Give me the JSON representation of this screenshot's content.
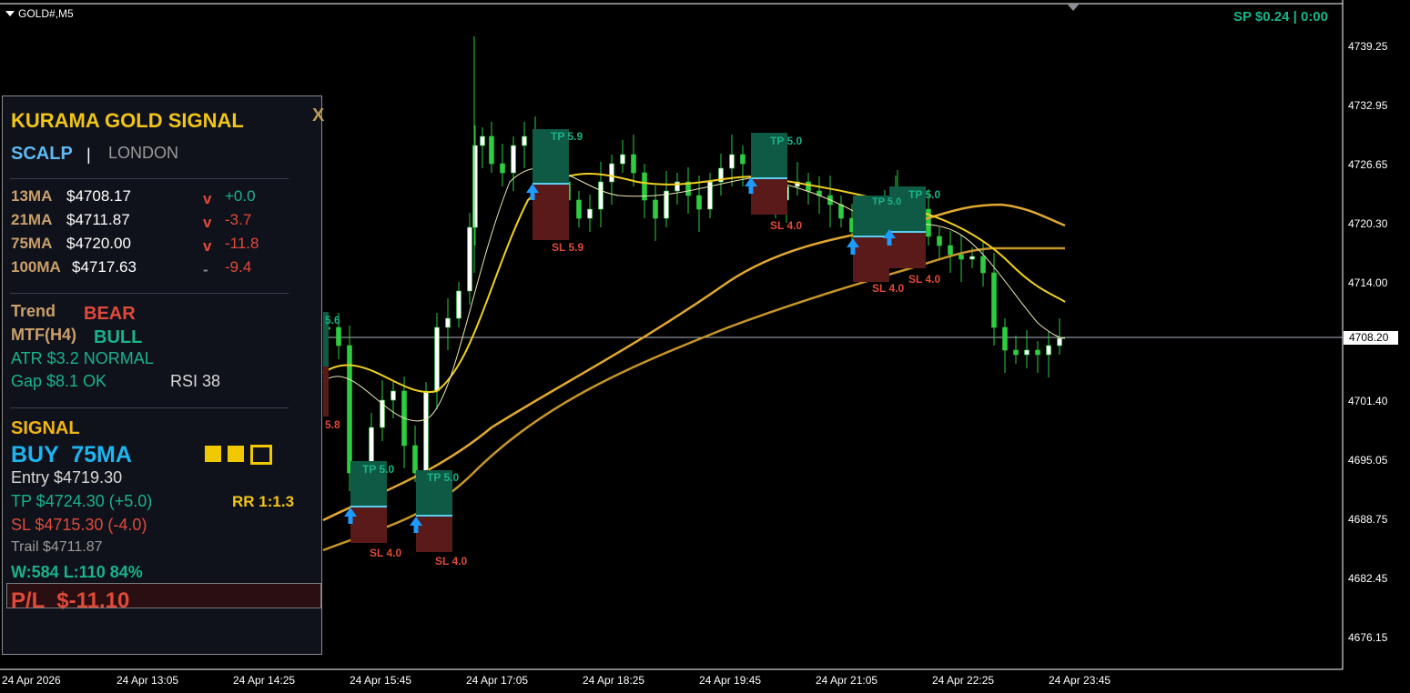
{
  "symbol": "GOLD#,M5",
  "spread_status": "SP $0.24  |  0:00",
  "current_price": "4708.20",
  "y_axis": [
    "4739.25",
    "4732.95",
    "4726.65",
    "4720.30",
    "4714.00",
    "4708.20",
    "4701.40",
    "4695.05",
    "4688.75",
    "4682.45",
    "4676.15"
  ],
  "x_axis": [
    "24 Apr 2026",
    "24 Apr 13:05",
    "24 Apr 14:25",
    "24 Apr 15:45",
    "24 Apr 17:05",
    "24 Apr 18:25",
    "24 Apr 19:45",
    "24 Apr 21:05",
    "24 Apr 22:25",
    "24 Apr 23:45"
  ],
  "trade_boxes": [
    {
      "tp": "TP 5.0",
      "sl": "SL 4.0"
    },
    {
      "tp": "TP 5.0",
      "sl": "SL 4.0"
    },
    {
      "tp": "TP 5.9",
      "sl": "SL 5.9"
    },
    {
      "tp": "TP 5.0",
      "sl": "SL 4.0"
    },
    {
      "tp": "TP 5.0",
      "sl": "SL 4.0"
    },
    {
      "tp": "TP 5.0",
      "sl": "SL 4.0"
    }
  ],
  "partial_labels": {
    "tp": "5.6",
    "sl": "5.8",
    "tp_overlap": "TP 5.0"
  },
  "colors": {
    "bull": "#2ecc40",
    "panel_gold": "#f0c419",
    "tp_green": "#19b38a",
    "sl_red": "#e04a3a",
    "arrow_blue": "#1e9bff"
  },
  "panel": {
    "title": "KURAMA GOLD SIGNAL",
    "close": "X",
    "mode": "SCALP",
    "divider": "|",
    "session": "LONDON",
    "mas": [
      {
        "name": "13MA",
        "value": "$4708.17",
        "dir": "v",
        "delta": "+0.0"
      },
      {
        "name": "21MA",
        "value": "$4711.87",
        "dir": "v",
        "delta": "-3.7"
      },
      {
        "name": "75MA",
        "value": "$4720.00",
        "dir": "v",
        "delta": "-11.8"
      },
      {
        "name": "100MA",
        "value": "$4717.63",
        "dir": "-",
        "delta": "-9.4"
      }
    ],
    "trend_label": "Trend",
    "trend_value": "BEAR",
    "mtf_label": "MTF(H4)",
    "mtf_value": "BULL",
    "atr": "ATR  $3.2  NORMAL",
    "gap": "Gap $8.1 OK",
    "rsi": "RSI 38",
    "signal_label": "SIGNAL",
    "signal_value": "BUY  75MA",
    "entry": "Entry  $4719.30",
    "tp": "TP  $4724.30  (+5.0)",
    "rr": "RR 1:1.3",
    "sl": "SL  $4715.30  (-4.0)",
    "trail": "Trail  $4711.87",
    "stats": "W:584 L:110  84%",
    "pl": "P/L  $-11.10"
  }
}
